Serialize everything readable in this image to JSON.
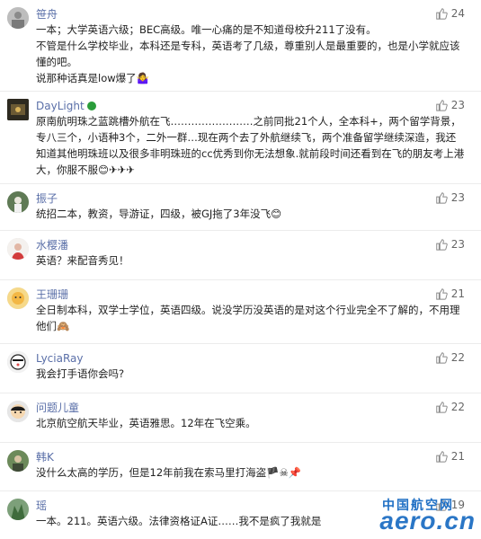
{
  "comments": [
    {
      "user": "笹舟",
      "likes": "24",
      "text": "一本；大学英语六级；BEC高级。唯一心痛的是不知道母校升211了没有。\n不管是什么学校毕业，本科还是专科，英语考了几级，尊重别人是最重要的，也是小学就应该懂的吧。\n说那种话真是low爆了🤷‍♀"
    },
    {
      "user": "DayLight",
      "likes": "23",
      "text": "原南航明珠之蓝跳槽外航在飞……………………之前同批21个人，全本科+，两个留学背景，专八三个，小语种3个，二外一群…现在两个去了外航继续飞，两个准备留学继续深造，我还知道其他明珠班以及很多非明珠班的cc优秀到你无法想象.就前段时间还看到在飞的朋友考上港大，你服不服😊✈✈✈"
    },
    {
      "user": "振子",
      "likes": "23",
      "text": "统招二本，教资，导游证，四级，被GJ拖了3年没飞😊"
    },
    {
      "user": "水樱潘",
      "likes": "23",
      "text": "英语？来配音秀见！"
    },
    {
      "user": "王珊珊",
      "likes": "21",
      "text": "全日制本科，双学士学位，英语四级。说没学历没英语的是对这个行业完全不了解的，不用理他们🙈"
    },
    {
      "user": "LyciaRay",
      "likes": "22",
      "text": "我会打手语你会吗?"
    },
    {
      "user": "问题儿童",
      "likes": "22",
      "text": "北京航空航天毕业，英语雅思。12年在飞空乘。"
    },
    {
      "user": "韩K",
      "likes": "21",
      "text": "没什么太高的学历，但是12年前我在索马里打海盗🏴☠📌"
    },
    {
      "user": "瑶",
      "likes": "19",
      "text": "一本。211。英语六级。法律资格证A证……我不是疯了我就是"
    }
  ],
  "watermark": {
    "cn": "中国航空网",
    "en": "aero.cn"
  },
  "colors": {
    "name": "#5a6fa8",
    "text": "#222222",
    "badge": "#2a9d3a",
    "watermark": "#1f6fc4"
  }
}
